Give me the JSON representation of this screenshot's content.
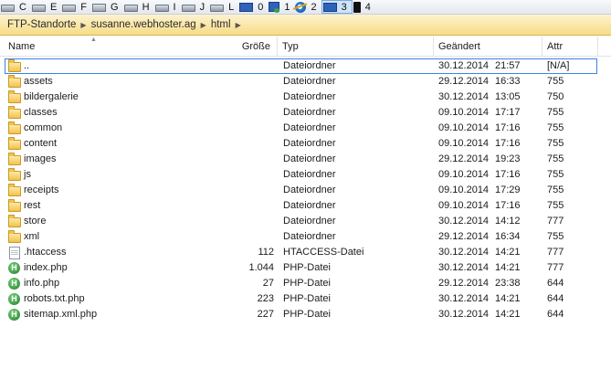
{
  "drivebar": {
    "drives": [
      {
        "letter": "C",
        "icon": "hdd-drive-icon"
      },
      {
        "letter": "E",
        "icon": "hdd-drive-icon"
      },
      {
        "letter": "F",
        "icon": "hdd-drive-icon"
      },
      {
        "letter": "G",
        "icon": "usb-drive-icon"
      },
      {
        "letter": "H",
        "icon": "hdd-drive-icon"
      },
      {
        "letter": "I",
        "icon": "hdd-drive-icon"
      },
      {
        "letter": "J",
        "icon": "hdd-drive-icon"
      },
      {
        "letter": "L",
        "icon": "hdd-drive-icon"
      },
      {
        "letter": "0",
        "icon": "desktop-monitor-icon"
      },
      {
        "letter": "1",
        "icon": "network-icon"
      },
      {
        "letter": "2",
        "icon": "internet-explorer-icon"
      },
      {
        "letter": "3",
        "icon": "computer-icon",
        "active": true
      },
      {
        "letter": "4",
        "icon": "phone-icon"
      }
    ]
  },
  "breadcrumb": {
    "items": [
      "FTP-Standorte",
      "susanne.webhoster.ag",
      "html"
    ]
  },
  "columns": {
    "name": "Name",
    "size": "Größe",
    "type": "Typ",
    "modified": "Geändert",
    "attr": "Attr"
  },
  "files": [
    {
      "name": "..",
      "size": "",
      "type": "Dateiordner",
      "date": "30.12.2014",
      "time": "21:57",
      "attr": "[N/A]",
      "icon": "folder"
    },
    {
      "name": "assets",
      "size": "",
      "type": "Dateiordner",
      "date": "29.12.2014",
      "time": "16:33",
      "attr": "755",
      "icon": "folder"
    },
    {
      "name": "bildergalerie",
      "size": "",
      "type": "Dateiordner",
      "date": "30.12.2014",
      "time": "13:05",
      "attr": "750",
      "icon": "folder"
    },
    {
      "name": "classes",
      "size": "",
      "type": "Dateiordner",
      "date": "09.10.2014",
      "time": "17:17",
      "attr": "755",
      "icon": "folder"
    },
    {
      "name": "common",
      "size": "",
      "type": "Dateiordner",
      "date": "09.10.2014",
      "time": "17:16",
      "attr": "755",
      "icon": "folder"
    },
    {
      "name": "content",
      "size": "",
      "type": "Dateiordner",
      "date": "09.10.2014",
      "time": "17:16",
      "attr": "755",
      "icon": "folder"
    },
    {
      "name": "images",
      "size": "",
      "type": "Dateiordner",
      "date": "29.12.2014",
      "time": "19:23",
      "attr": "755",
      "icon": "folder"
    },
    {
      "name": "js",
      "size": "",
      "type": "Dateiordner",
      "date": "09.10.2014",
      "time": "17:16",
      "attr": "755",
      "icon": "folder"
    },
    {
      "name": "receipts",
      "size": "",
      "type": "Dateiordner",
      "date": "09.10.2014",
      "time": "17:29",
      "attr": "755",
      "icon": "folder"
    },
    {
      "name": "rest",
      "size": "",
      "type": "Dateiordner",
      "date": "09.10.2014",
      "time": "17:16",
      "attr": "755",
      "icon": "folder"
    },
    {
      "name": "store",
      "size": "",
      "type": "Dateiordner",
      "date": "30.12.2014",
      "time": "14:12",
      "attr": "777",
      "icon": "folder"
    },
    {
      "name": "xml",
      "size": "",
      "type": "Dateiordner",
      "date": "29.12.2014",
      "time": "16:34",
      "attr": "755",
      "icon": "folder"
    },
    {
      "name": ".htaccess",
      "size": "112",
      "type": "HTACCESS-Datei",
      "date": "30.12.2014",
      "time": "14:21",
      "attr": "777",
      "icon": "file"
    },
    {
      "name": "index.php",
      "size": "1.044",
      "type": "PHP-Datei",
      "date": "30.12.2014",
      "time": "14:21",
      "attr": "777",
      "icon": "php"
    },
    {
      "name": "info.php",
      "size": "27",
      "type": "PHP-Datei",
      "date": "29.12.2014",
      "time": "23:38",
      "attr": "644",
      "icon": "php"
    },
    {
      "name": "robots.txt.php",
      "size": "223",
      "type": "PHP-Datei",
      "date": "30.12.2014",
      "time": "14:21",
      "attr": "644",
      "icon": "php"
    },
    {
      "name": "sitemap.xml.php",
      "size": "227",
      "type": "PHP-Datei",
      "date": "30.12.2014",
      "time": "14:21",
      "attr": "644",
      "icon": "php"
    }
  ]
}
